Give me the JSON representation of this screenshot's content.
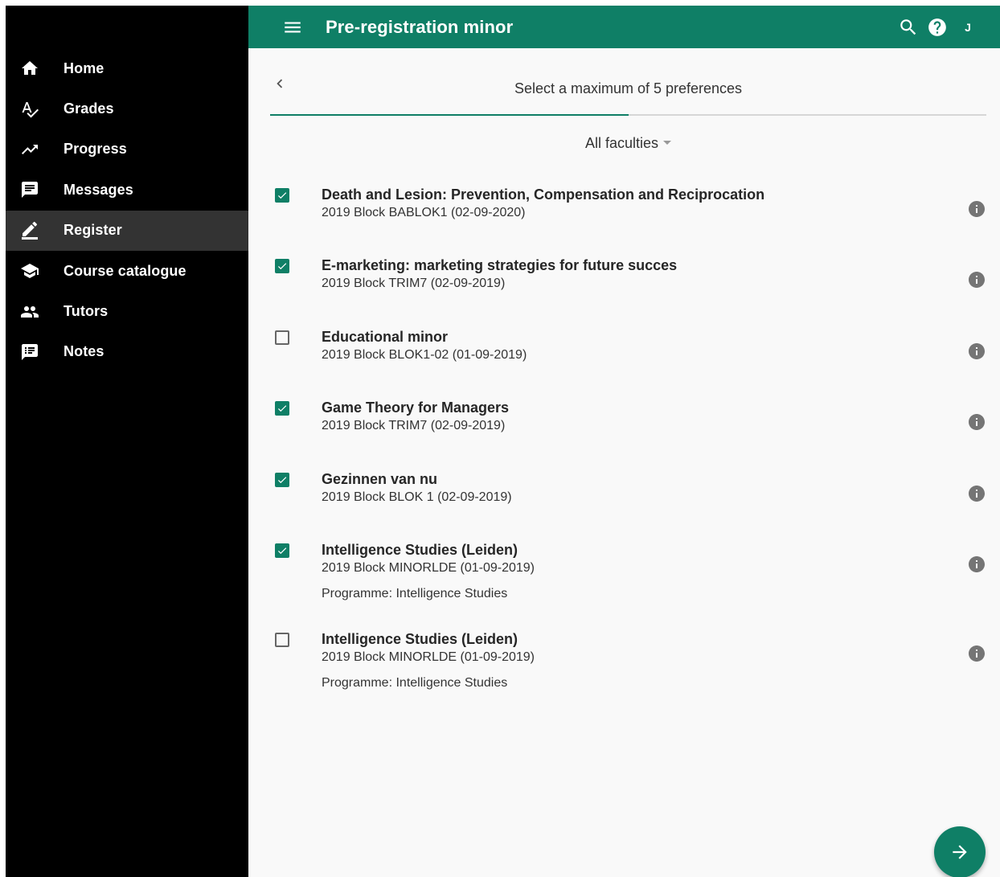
{
  "topbar": {
    "title": "Pre-registration minor",
    "user_initial": "J",
    "icons": [
      "menu-icon",
      "search-icon",
      "help-icon"
    ]
  },
  "sidebar": {
    "items": [
      {
        "label": "Home",
        "icon": "home-icon",
        "active": false
      },
      {
        "label": "Grades",
        "icon": "grades-icon",
        "active": false
      },
      {
        "label": "Progress",
        "icon": "trending-up-icon",
        "active": false
      },
      {
        "label": "Messages",
        "icon": "message-icon",
        "active": false
      },
      {
        "label": "Register",
        "icon": "edit-icon",
        "active": true
      },
      {
        "label": "Course catalogue",
        "icon": "school-icon",
        "active": false
      },
      {
        "label": "Tutors",
        "icon": "people-icon",
        "active": false
      },
      {
        "label": "Notes",
        "icon": "notes-icon",
        "active": false
      }
    ]
  },
  "step": {
    "title": "Select a maximum of 5 preferences",
    "progress": 0.5
  },
  "filter": {
    "faculty": "All faculties"
  },
  "minors": [
    {
      "title": "Death and Lesion: Prevention, Compensation and Reciprocation",
      "subtitle": "2019 Block BABLOK1 (02-09-2020)",
      "checked": true
    },
    {
      "title": "E-marketing: marketing strategies for future succes",
      "subtitle": "2019 Block TRIM7 (02-09-2019)",
      "checked": true
    },
    {
      "title": "Educational minor",
      "subtitle": "2019 Block BLOK1-02 (01-09-2019)",
      "checked": false
    },
    {
      "title": "Game Theory for Managers",
      "subtitle": "2019 Block TRIM7 (02-09-2019)",
      "checked": true
    },
    {
      "title": "Gezinnen van nu",
      "subtitle": "2019 Block BLOK 1 (02-09-2019)",
      "checked": true
    },
    {
      "title": "Intelligence Studies (Leiden)",
      "subtitle": "2019 Block MINORLDE (01-09-2019)",
      "programme": "Programme: Intelligence Studies",
      "checked": true
    },
    {
      "title": "Intelligence Studies (Leiden)",
      "subtitle": "2019 Block MINORLDE (01-09-2019)",
      "programme": "Programme: Intelligence Studies",
      "checked": false
    }
  ],
  "colors": {
    "primary": "#0f7f66",
    "sidebar_bg": "#000000",
    "sidebar_active": "#333333",
    "content_bg": "#f9f9f9"
  },
  "fab": {
    "icon": "arrow-forward-icon"
  }
}
